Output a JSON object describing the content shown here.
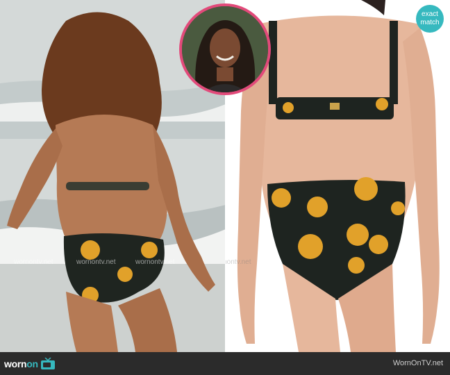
{
  "badge": {
    "line1": "exact",
    "line2": "match"
  },
  "footer": {
    "logo_word": "worn",
    "logo_on": "on",
    "site": "WornOnTV.net"
  },
  "watermarks": [
    "wornontv.net",
    "wornontv.net",
    "wornontv.net",
    "wornontv.net"
  ],
  "colors": {
    "accent_teal": "#36b9bf",
    "inset_ring": "#e24a7a",
    "footer_bg": "#2b2b2b"
  }
}
